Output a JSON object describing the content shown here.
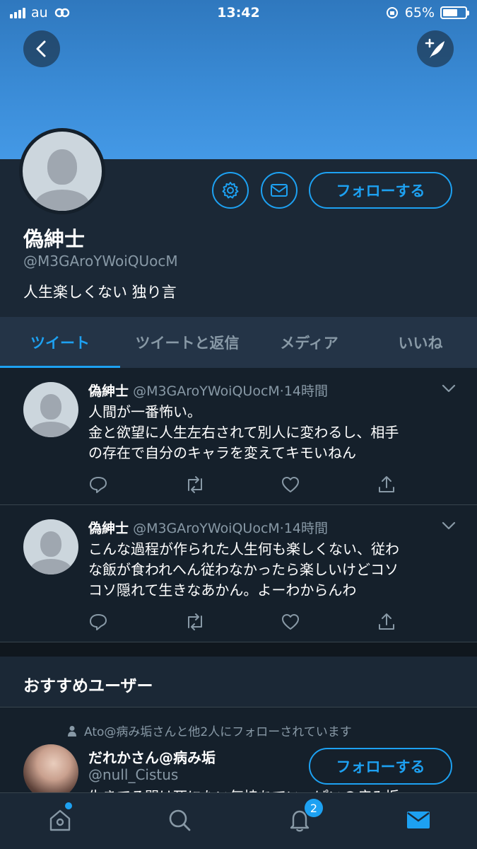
{
  "status_bar": {
    "carrier": "au",
    "time": "13:42",
    "battery": "65%",
    "battery_level": 0.65
  },
  "profile": {
    "display_name": "偽紳士",
    "handle": "@M3GAroYWoiQUocM",
    "bio": "人生楽しくない 独り言",
    "follow_label": "フォローする"
  },
  "tabs": [
    {
      "label": "ツイート",
      "active": true
    },
    {
      "label": "ツイートと返信",
      "active": false
    },
    {
      "label": "メディア",
      "active": false
    },
    {
      "label": "いいね",
      "active": false
    }
  ],
  "tweets": [
    {
      "name": "偽紳士",
      "handle": "@M3GAroYWoiQUocM",
      "time": "14時間",
      "lines": [
        "人間が一番怖い。",
        "金と欲望に人生左右されて別人に変わるし、相手",
        "の存在で自分のキャラを変えてキモいねん"
      ]
    },
    {
      "name": "偽紳士",
      "handle": "@M3GAroYWoiQUocM",
      "time": "14時間",
      "lines": [
        "こんな過程が作られた人生何も楽しくない、従わ",
        "な飯が食われへん従わなかったら楽しいけどコソ",
        "コソ隠れて生きなあかん。よーわからんわ"
      ]
    }
  ],
  "recommended": {
    "title": "おすすめユーザー",
    "social_context": "Ato@病み垢さんと他2人にフォローされています",
    "name": "だれかさん@病み垢",
    "handle": "@null_Cistus",
    "bio": "生きてる間は死にたい気持ちでいっぱいの病み垢",
    "follow_label": "フォローする"
  },
  "tabbar": {
    "notification_count": "2"
  },
  "colors": {
    "accent": "#1da1f2",
    "background": "#15202b",
    "secondary_text": "#8899a6"
  }
}
